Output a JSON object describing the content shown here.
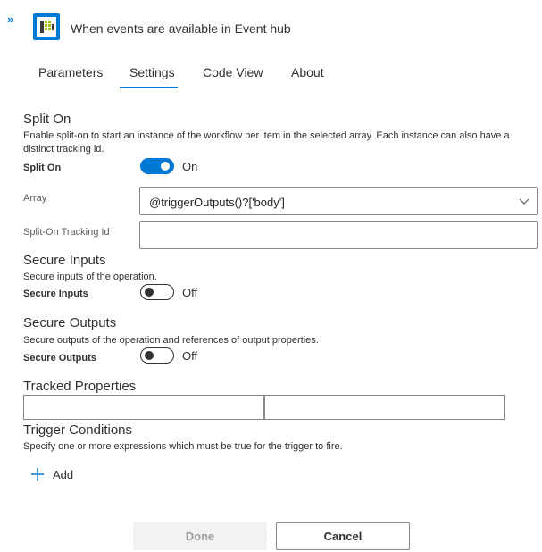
{
  "header": {
    "expand_glyph": "»",
    "icon": "event-hub-icon",
    "title": "When events are available in Event hub"
  },
  "tabs": [
    {
      "label": "Parameters"
    },
    {
      "label": "Settings",
      "active": true
    },
    {
      "label": "Code View"
    },
    {
      "label": "About"
    }
  ],
  "split_on": {
    "title": "Split On",
    "description": "Enable split-on to start an instance of the workflow per item in the selected array. Each instance can also have a distinct tracking id.",
    "toggle_label": "Split On",
    "state": "On",
    "array_label": "Array",
    "array_value": "@triggerOutputs()?['body']",
    "tracking_label": "Split-On Tracking Id",
    "tracking_value": ""
  },
  "secure_inputs": {
    "title": "Secure Inputs",
    "description": "Secure inputs of the operation.",
    "toggle_label": "Secure Inputs",
    "state": "Off"
  },
  "secure_outputs": {
    "title": "Secure Outputs",
    "description": "Secure outputs of the operation and references of output properties.",
    "toggle_label": "Secure Outputs",
    "state": "Off"
  },
  "tracked_properties": {
    "title": "Tracked Properties"
  },
  "trigger_conditions": {
    "title": "Trigger Conditions",
    "description": "Specify one or more expressions which must be true for the trigger to fire.",
    "add_label": "Add"
  },
  "footer": {
    "done_label": "Done",
    "cancel_label": "Cancel"
  },
  "colors": {
    "accent": "#0078d4",
    "icon_dark": "#3b3a39",
    "icon_green": "#a4c400"
  }
}
